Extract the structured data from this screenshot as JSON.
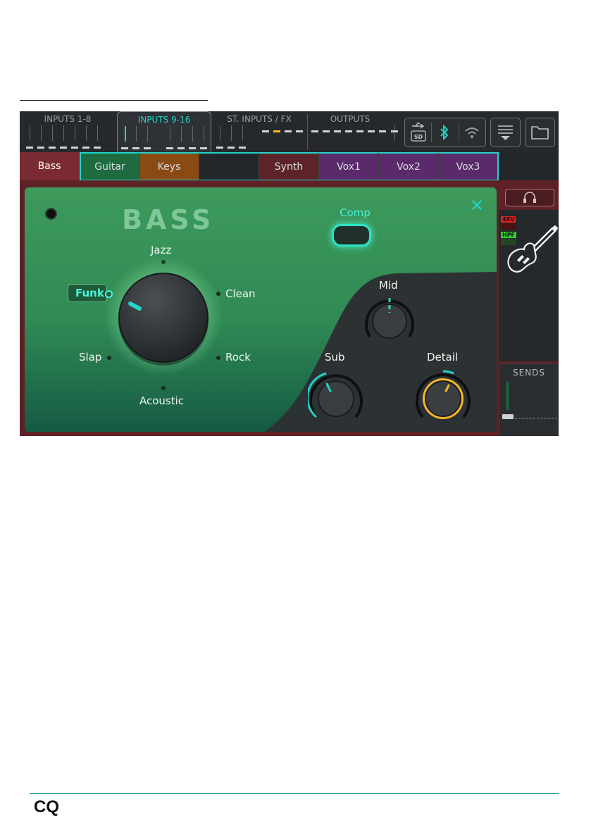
{
  "topbar": {
    "sections": [
      "INPUTS 1-8",
      "INPUTS 9-16",
      "ST. INPUTS / FX",
      "OUTPUTS"
    ],
    "active_section": "INPUTS 9-16",
    "icons": [
      "usb-icon",
      "sd-card-icon",
      "bluetooth-icon",
      "wifi-icon",
      "menu-icon",
      "folder-icon"
    ]
  },
  "channel_tabs": [
    {
      "label": "Bass",
      "color": "#7a2b31",
      "selected": true
    },
    {
      "label": "Guitar",
      "color": "#1e6b3f"
    },
    {
      "label": "Keys",
      "color": "#8a4a14"
    },
    {
      "label": "",
      "color": "#24272a"
    },
    {
      "label": "Synth",
      "color": "#5c2429"
    },
    {
      "label": "Vox1",
      "color": "#5a2a6b"
    },
    {
      "label": "Vox2",
      "color": "#5a2a6b"
    },
    {
      "label": "Vox3",
      "color": "#5a2a6b"
    }
  ],
  "panel": {
    "title": "BASS",
    "comp_label": "Comp",
    "presets": {
      "selected": "Funk",
      "options": [
        "Jazz",
        "Clean",
        "Rock",
        "Acoustic",
        "Slap",
        "Funk"
      ]
    },
    "knobs": {
      "mid": "Mid",
      "sub": "Sub",
      "detail": "Detail"
    }
  },
  "right_strip": {
    "badges": [
      "48V",
      "HPF"
    ],
    "sends_label": "SENDS"
  },
  "footer": {
    "logo": "CQ"
  },
  "colors": {
    "accent": "#22d3c8",
    "detail_ring": "#f5b921",
    "channel_bg": "#5e2226"
  }
}
